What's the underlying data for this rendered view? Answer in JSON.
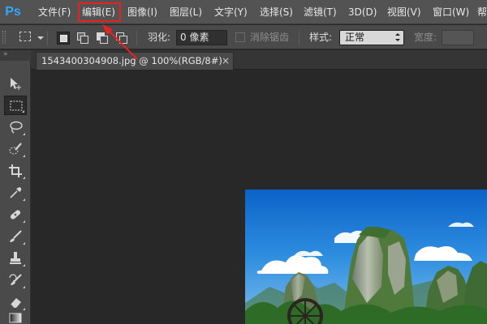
{
  "app": {
    "logo": "Ps"
  },
  "menu": [
    {
      "label": "文件(F)"
    },
    {
      "label": "编辑(E)",
      "highlighted": true
    },
    {
      "label": "图像(I)"
    },
    {
      "label": "图层(L)"
    },
    {
      "label": "文字(Y)"
    },
    {
      "label": "选择(S)"
    },
    {
      "label": "滤镜(T)"
    },
    {
      "label": "3D(D)"
    },
    {
      "label": "视图(V)"
    },
    {
      "label": "窗口(W)"
    },
    {
      "label": "帮"
    }
  ],
  "options": {
    "feather_label": "羽化:",
    "feather_value": "0 像素",
    "antialias_label": "消除锯齿",
    "style_label": "样式:",
    "style_value": "正常",
    "width_label": "宽度:"
  },
  "panel": {
    "collapse_glyph": "»"
  },
  "document_tab": {
    "title": "1543400304908.jpg @ 100%(RGB/8#)",
    "close_glyph": "×"
  },
  "tools": [
    {
      "icon": "move-icon"
    },
    {
      "icon": "rectangular-marquee-icon",
      "active": true
    },
    {
      "icon": "lasso-icon"
    },
    {
      "icon": "quick-selection-icon"
    },
    {
      "icon": "crop-icon"
    },
    {
      "icon": "eyedropper-icon"
    },
    {
      "icon": "healing-brush-icon"
    },
    {
      "icon": "brush-icon"
    },
    {
      "icon": "clone-stamp-icon"
    },
    {
      "icon": "history-brush-icon"
    },
    {
      "icon": "eraser-icon"
    },
    {
      "icon": "gradient-icon"
    }
  ],
  "colors": {
    "menu_bg": "#535353",
    "toolbox_bg": "#4a4a4a",
    "canvas_bg": "#282828",
    "highlight_red": "#e8211f",
    "ps_blue": "#31a8ff"
  }
}
